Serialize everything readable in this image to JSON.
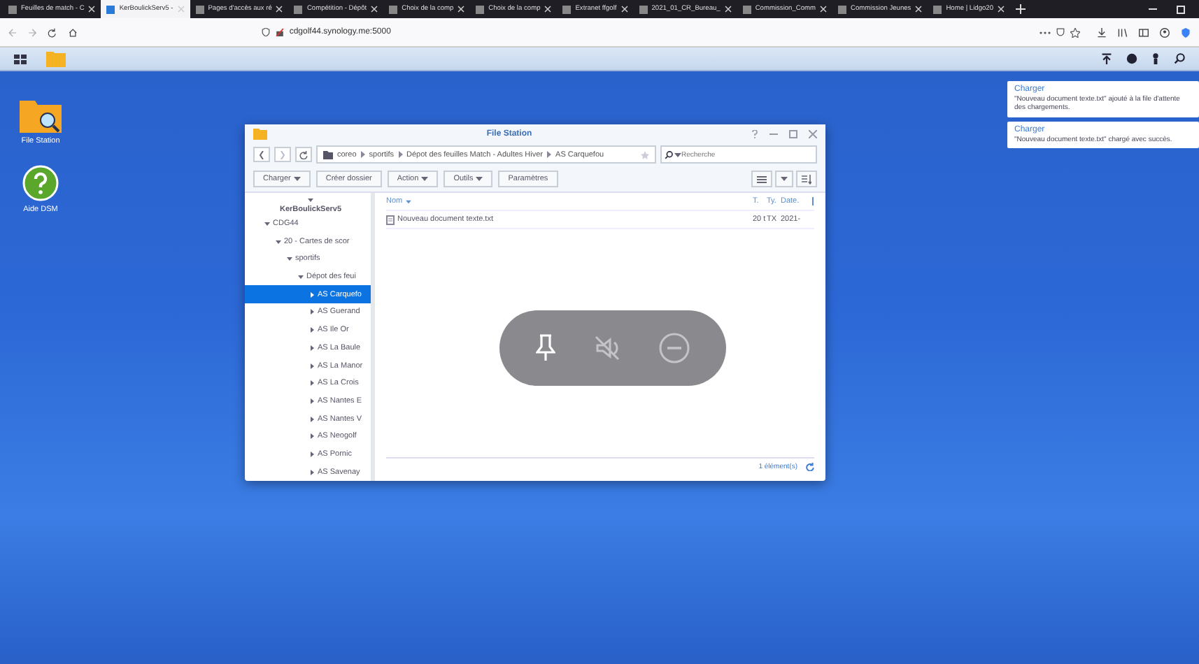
{
  "browser": {
    "tabs": [
      {
        "label": "Feuilles de match - C",
        "selected": false
      },
      {
        "label": "KerBoulickServ5 -",
        "selected": true
      },
      {
        "label": "Pages d'accès aux ré",
        "selected": false
      },
      {
        "label": "Compétition - Dépôt",
        "selected": false
      },
      {
        "label": "Choix de la comp",
        "selected": false
      },
      {
        "label": "Choix de la comp",
        "selected": false
      },
      {
        "label": "Extranet ffgolf",
        "selected": false
      },
      {
        "label": "2021_01_CR_Bureau_",
        "selected": false
      },
      {
        "label": "Commission_Comm",
        "selected": false
      },
      {
        "label": "Commission Jeunes",
        "selected": false
      },
      {
        "label": "Home | Lidgo20",
        "selected": false
      }
    ],
    "url": "cdgolf44.synology.me:5000"
  },
  "desktop": {
    "icons": [
      {
        "label": "File Station",
        "kind": "folder"
      },
      {
        "label": "Aide DSM",
        "kind": "help"
      }
    ]
  },
  "file_station": {
    "title": "File Station",
    "path": [
      "coreo",
      "sportifs",
      "Dépot des feuilles Match - Adultes Hiver",
      "AS Carquefou"
    ],
    "search": {
      "placeholder": "Recherche"
    },
    "toolbar": [
      {
        "label": "Charger",
        "dropdown": true
      },
      {
        "label": "Créer dossier",
        "dropdown": false
      },
      {
        "label": "Action",
        "dropdown": true
      },
      {
        "label": "Outils",
        "dropdown": true
      },
      {
        "label": "Paramètres",
        "dropdown": false
      }
    ],
    "tree": [
      {
        "label": "KerBoulickServ5",
        "expanded": true,
        "selected": false,
        "children": [
          {
            "label": "CDG44",
            "expanded": true,
            "selected": false,
            "children": [
              {
                "label": "20 - Cartes de scor",
                "expanded": true,
                "selected": false,
                "children": [
                  {
                    "label": "sportifs",
                    "expanded": true,
                    "selected": false,
                    "children": [
                      {
                        "label": "Dépot des feui",
                        "expanded": true,
                        "selected": false,
                        "children": [
                          {
                            "label": "AS Carquefo",
                            "expanded": false,
                            "selected": true
                          },
                          {
                            "label": "AS Guerand",
                            "expanded": false,
                            "selected": false
                          },
                          {
                            "label": "AS Ile Or",
                            "expanded": false,
                            "selected": false
                          },
                          {
                            "label": "AS La Baule",
                            "expanded": false,
                            "selected": false
                          },
                          {
                            "label": "AS La Manor",
                            "expanded": false,
                            "selected": false
                          },
                          {
                            "label": "AS La Crois",
                            "expanded": false,
                            "selected": false
                          },
                          {
                            "label": "AS Nantes E",
                            "expanded": false,
                            "selected": false
                          },
                          {
                            "label": "AS Nantes V",
                            "expanded": false,
                            "selected": false
                          },
                          {
                            "label": "AS Neogolf",
                            "expanded": false,
                            "selected": false
                          },
                          {
                            "label": "AS Pornic",
                            "expanded": false,
                            "selected": false
                          },
                          {
                            "label": "AS Savenay",
                            "expanded": false,
                            "selected": false
                          }
                        ]
                      }
                    ]
                  }
                ]
              }
            ]
          }
        ]
      }
    ],
    "columns": [
      "Nom",
      "T.",
      "Ty.",
      "Date."
    ],
    "rows": [
      [
        "Nouveau document texte.txt",
        "20 t",
        "TX",
        "2021-"
      ]
    ],
    "status": "1 élément(s)"
  },
  "notifications": [
    {
      "title": "Charger",
      "text": "\"Nouveau document texte.txt\" ajouté à la file d'attente des chargements."
    },
    {
      "title": "Charger",
      "text": "\"Nouveau document texte.txt\" chargé avec succès."
    }
  ]
}
